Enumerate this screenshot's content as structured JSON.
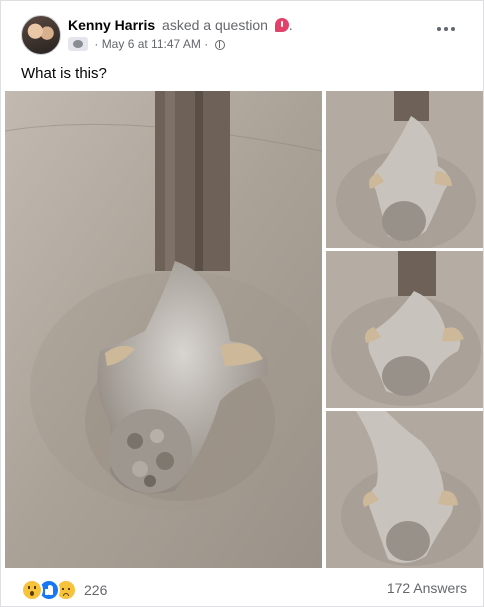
{
  "post": {
    "author": "Kenny Harris",
    "action": "asked a question",
    "question_icon": "question-badge-icon",
    "date": "May 6 at 11:47 AM",
    "privacy_icon": "globe-icon",
    "group_icon": "group-icon",
    "more_icon": "more-options-icon",
    "caption": "What is this?",
    "meta_separator": "·"
  },
  "photos": {
    "count": 4,
    "subject": "stingray-like creature on wet sand"
  },
  "footer": {
    "reaction_icons": [
      "wow-reaction-icon",
      "like-reaction-icon",
      "sad-reaction-icon"
    ],
    "reaction_count": "226",
    "answers": "172 Answers"
  },
  "colors": {
    "accent": "#1877f2",
    "question_badge": "#e4416a",
    "secondary_text": "#65676b",
    "sand": "#b7aea4"
  }
}
